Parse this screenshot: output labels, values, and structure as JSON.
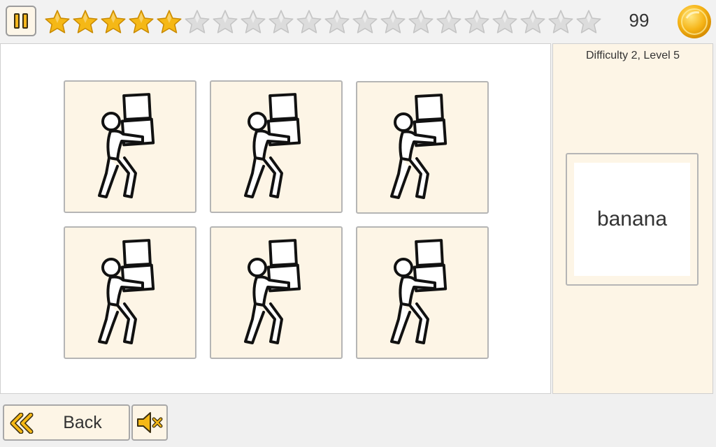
{
  "header": {
    "score": "99",
    "stars_filled": 5,
    "stars_total": 20,
    "star_color": "#f5b816",
    "empty_star_color": "#dcdcdc"
  },
  "board": {
    "cards": [
      {
        "icon": "person-carrying-boxes-icon"
      },
      {
        "icon": "person-carrying-boxes-icon"
      },
      {
        "icon": "person-carrying-boxes-icon"
      },
      {
        "icon": "person-carrying-boxes-icon"
      },
      {
        "icon": "person-carrying-boxes-icon"
      },
      {
        "icon": "person-carrying-boxes-icon"
      }
    ]
  },
  "sidebar": {
    "level_label": "Difficulty 2, Level 5",
    "word": "banana"
  },
  "footer": {
    "back_label": "Back",
    "back_icon": "double-chevron-left-icon",
    "mute_icon": "speaker-muted-icon"
  },
  "colors": {
    "accent": "#f5b816",
    "card_bg": "#fdf5e6"
  }
}
